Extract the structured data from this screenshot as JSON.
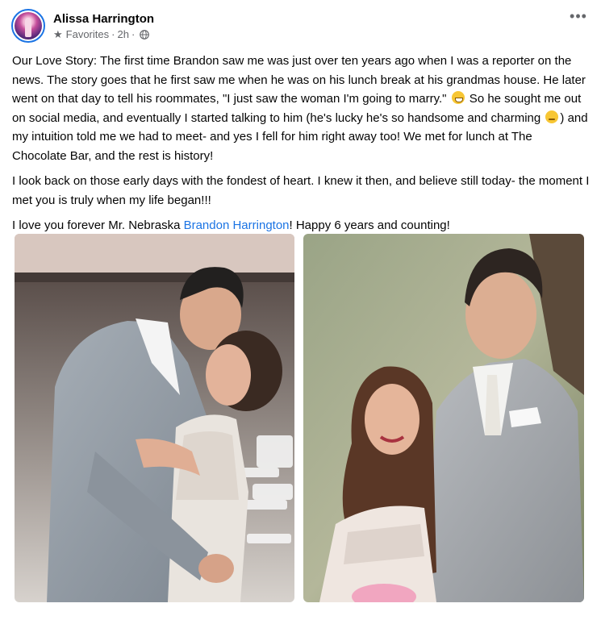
{
  "post": {
    "author": "Alissa Harrington",
    "audience": "Favorites",
    "separator": "·",
    "time": "2h",
    "more": "•••",
    "paragraphs": {
      "p1_a": "Our Love Story: The first time Brandon saw me was just over ten years ago when I was a reporter on the news. The story goes that he first saw me when he was on his lunch break at his grandmas house. He later went on that day to tell his roommates, \"I just saw the woman I'm going to marry.\"",
      "p1_b": " So he sought me out on social media, and eventually I started talking to him (he's lucky he's so handsome and charming ",
      "p1_c": ") and my intuition told me we had to meet- and yes I fell for him right away too! We met for lunch at The Chocolate Bar, and the rest is history!",
      "p2": "I look back on those early days with the fondest of heart. I knew it then, and believe still today- the moment I met you is truly when my life began!!!",
      "p3_a": "I love you forever Mr. Nebraska ",
      "p3_link": "Brandon Harrington",
      "p3_b": "! Happy 6 years and counting!"
    },
    "icons": {
      "audience": "star-icon",
      "privacy": "globe-icon",
      "emoji_1": "grinning-face-emoji",
      "emoji_2": "winking-face-emoji"
    },
    "photos": [
      "kiss-photo",
      "portrait-photo"
    ]
  },
  "colors": {
    "link": "#1b74e4",
    "secondary_text": "#65676b",
    "avatar_ring": "#1b74e4"
  }
}
